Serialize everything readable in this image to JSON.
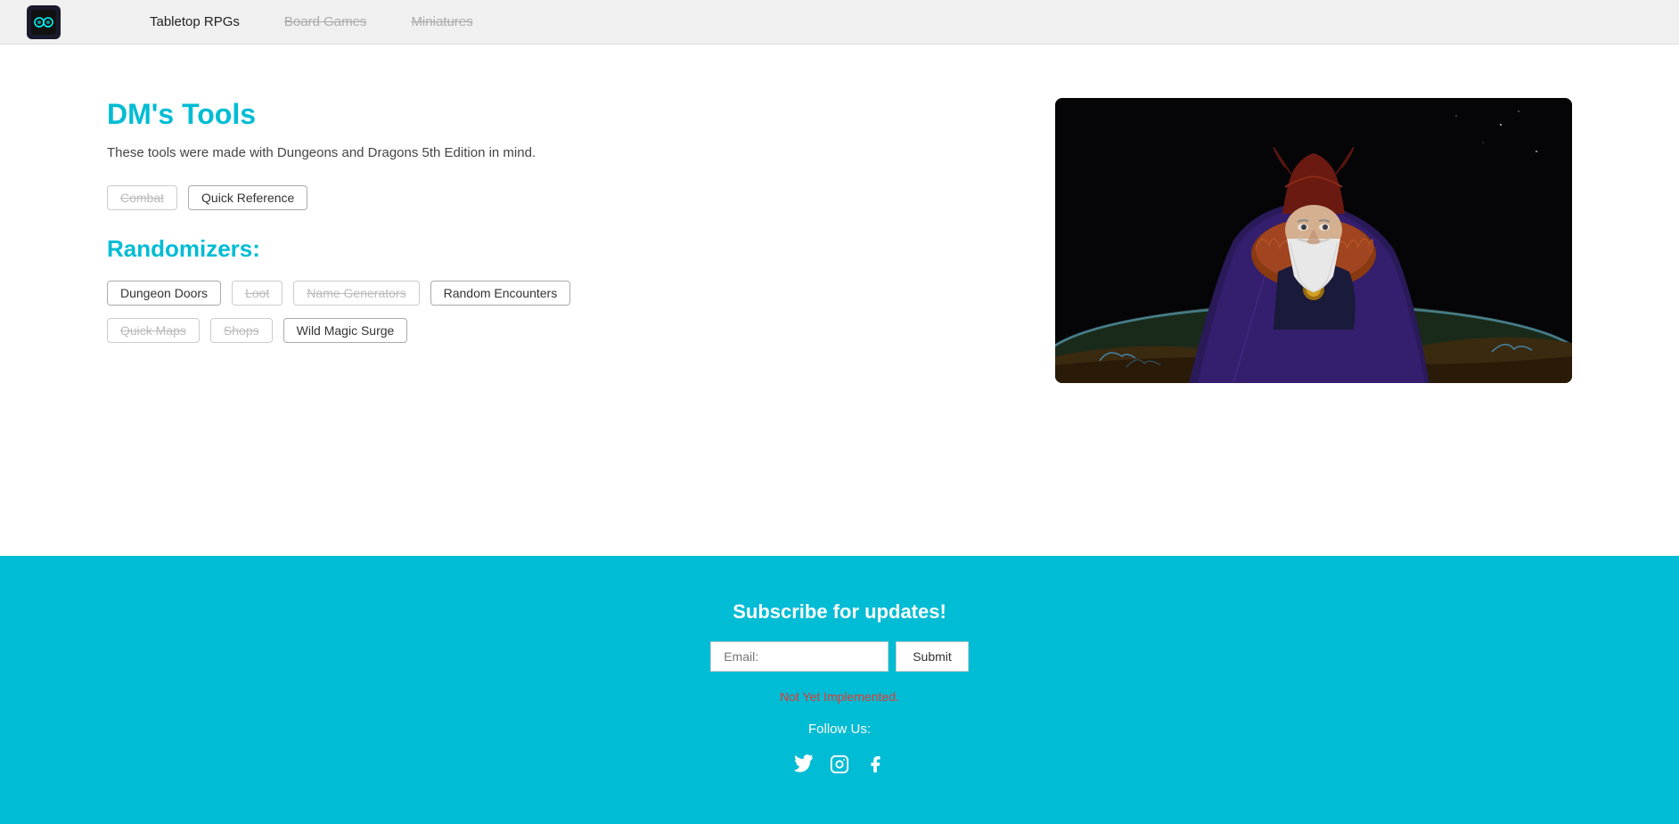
{
  "navbar": {
    "logo_icon": "🎭",
    "links": [
      {
        "id": "tabletop-rpgs",
        "label": "Tabletop RPGs",
        "state": "active"
      },
      {
        "id": "board-games",
        "label": "Board Games",
        "state": "inactive"
      },
      {
        "id": "miniatures",
        "label": "Miniatures",
        "state": "inactive"
      }
    ]
  },
  "main": {
    "title": "DM's Tools",
    "description": "These tools were made with Dungeons and Dragons 5th Edition in mind.",
    "tools_section": {
      "items": [
        {
          "id": "combat",
          "label": "Combat",
          "state": "inactive"
        },
        {
          "id": "quick-reference",
          "label": "Quick Reference",
          "state": "active"
        }
      ]
    },
    "randomizers_section": {
      "title": "Randomizers:",
      "rows": [
        [
          {
            "id": "dungeon-doors",
            "label": "Dungeon Doors",
            "state": "active"
          },
          {
            "id": "loot",
            "label": "Loot",
            "state": "strikethrough"
          },
          {
            "id": "name-generators",
            "label": "Name Generators",
            "state": "strikethrough"
          },
          {
            "id": "random-encounters",
            "label": "Random Encounters",
            "state": "active"
          }
        ],
        [
          {
            "id": "quick-maps",
            "label": "Quick Maps",
            "state": "strikethrough"
          },
          {
            "id": "shops",
            "label": "Shops",
            "state": "strikethrough"
          },
          {
            "id": "wild-magic-surge",
            "label": "Wild Magic Surge",
            "state": "active"
          }
        ]
      ]
    }
  },
  "footer": {
    "subscribe_title": "Subscribe for updates!",
    "email_placeholder": "Email:",
    "submit_label": "Submit",
    "not_implemented": "Not Yet Implemented.",
    "follow_label": "Follow Us:",
    "social_links": [
      {
        "id": "twitter",
        "icon": "🐦",
        "label": "Twitter"
      },
      {
        "id": "instagram",
        "icon": "📷",
        "label": "Instagram"
      },
      {
        "id": "facebook",
        "icon": "📘",
        "label": "Facebook"
      }
    ]
  }
}
